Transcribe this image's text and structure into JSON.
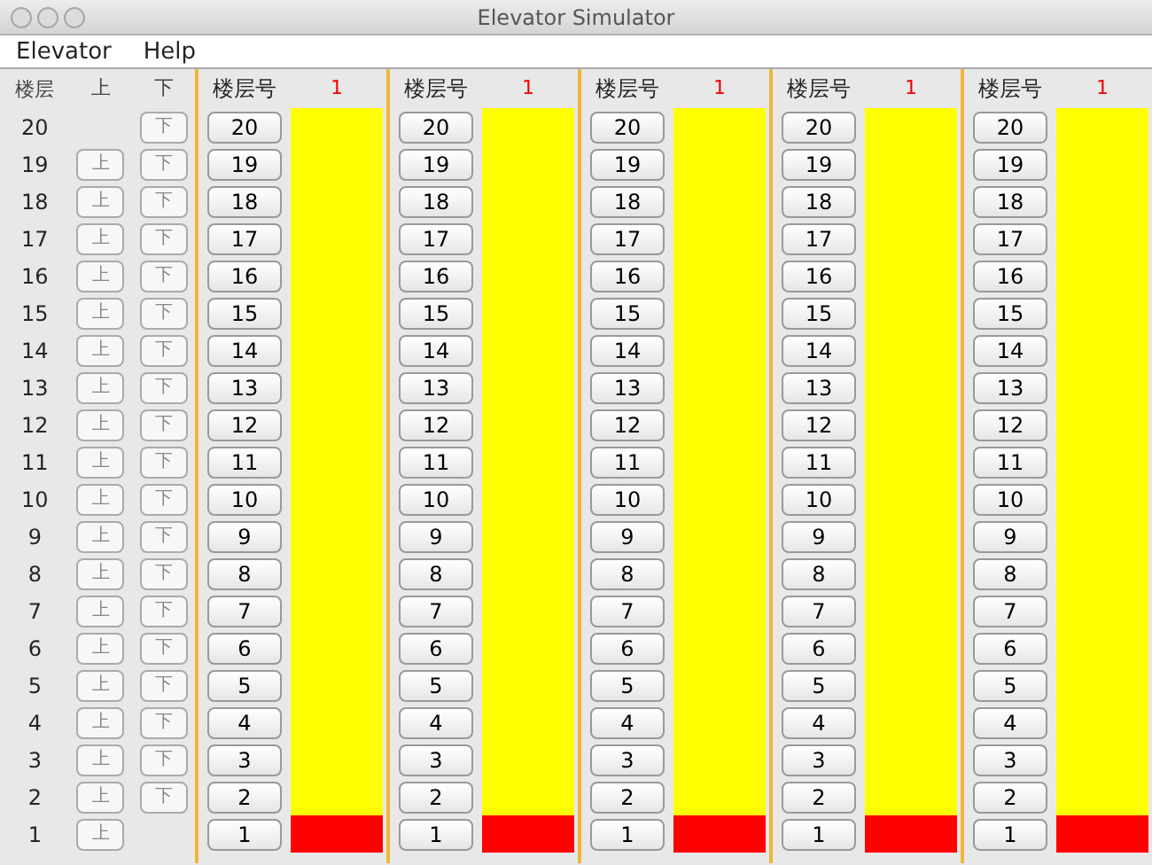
{
  "window": {
    "title": "Elevator Simulator"
  },
  "menu": [
    "Elevator",
    "Help"
  ],
  "hall": {
    "headers": [
      "楼层",
      "上",
      "下"
    ],
    "rows": [
      {
        "floor": "20",
        "down": "下"
      },
      {
        "floor": "19",
        "up": "上",
        "down": "下"
      },
      {
        "floor": "18",
        "up": "上",
        "down": "下"
      },
      {
        "floor": "17",
        "up": "上",
        "down": "下"
      },
      {
        "floor": "16",
        "up": "上",
        "down": "下"
      },
      {
        "floor": "15",
        "up": "上",
        "down": "下"
      },
      {
        "floor": "14",
        "up": "上",
        "down": "下"
      },
      {
        "floor": "13",
        "up": "上",
        "down": "下"
      },
      {
        "floor": "12",
        "up": "上",
        "down": "下"
      },
      {
        "floor": "11",
        "up": "上",
        "down": "下"
      },
      {
        "floor": "10",
        "up": "上",
        "down": "下"
      },
      {
        "floor": "9",
        "up": "上",
        "down": "下"
      },
      {
        "floor": "8",
        "up": "上",
        "down": "下"
      },
      {
        "floor": "7",
        "up": "上",
        "down": "下"
      },
      {
        "floor": "6",
        "up": "上",
        "down": "下"
      },
      {
        "floor": "5",
        "up": "上",
        "down": "下"
      },
      {
        "floor": "4",
        "up": "上",
        "down": "下"
      },
      {
        "floor": "3",
        "up": "上",
        "down": "下"
      },
      {
        "floor": "2",
        "up": "上",
        "down": "下"
      },
      {
        "floor": "1",
        "up": "上"
      }
    ]
  },
  "elevators": [
    {
      "header": "楼层号",
      "display": "1",
      "floors": [
        {
          "label": "20",
          "car": false
        },
        {
          "label": "19",
          "car": false
        },
        {
          "label": "18",
          "car": false
        },
        {
          "label": "17",
          "car": false
        },
        {
          "label": "16",
          "car": false
        },
        {
          "label": "15",
          "car": false
        },
        {
          "label": "14",
          "car": false
        },
        {
          "label": "13",
          "car": false
        },
        {
          "label": "12",
          "car": false
        },
        {
          "label": "11",
          "car": false
        },
        {
          "label": "10",
          "car": false
        },
        {
          "label": "9",
          "car": false
        },
        {
          "label": "8",
          "car": false
        },
        {
          "label": "7",
          "car": false
        },
        {
          "label": "6",
          "car": false
        },
        {
          "label": "5",
          "car": false
        },
        {
          "label": "4",
          "car": false
        },
        {
          "label": "3",
          "car": false
        },
        {
          "label": "2",
          "car": false
        },
        {
          "label": "1",
          "car": true
        }
      ]
    },
    {
      "header": "楼层号",
      "display": "1",
      "floors": [
        {
          "label": "20",
          "car": false
        },
        {
          "label": "19",
          "car": false
        },
        {
          "label": "18",
          "car": false
        },
        {
          "label": "17",
          "car": false
        },
        {
          "label": "16",
          "car": false
        },
        {
          "label": "15",
          "car": false
        },
        {
          "label": "14",
          "car": false
        },
        {
          "label": "13",
          "car": false
        },
        {
          "label": "12",
          "car": false
        },
        {
          "label": "11",
          "car": false
        },
        {
          "label": "10",
          "car": false
        },
        {
          "label": "9",
          "car": false
        },
        {
          "label": "8",
          "car": false
        },
        {
          "label": "7",
          "car": false
        },
        {
          "label": "6",
          "car": false
        },
        {
          "label": "5",
          "car": false
        },
        {
          "label": "4",
          "car": false
        },
        {
          "label": "3",
          "car": false
        },
        {
          "label": "2",
          "car": false
        },
        {
          "label": "1",
          "car": true
        }
      ]
    },
    {
      "header": "楼层号",
      "display": "1",
      "floors": [
        {
          "label": "20",
          "car": false
        },
        {
          "label": "19",
          "car": false
        },
        {
          "label": "18",
          "car": false
        },
        {
          "label": "17",
          "car": false
        },
        {
          "label": "16",
          "car": false
        },
        {
          "label": "15",
          "car": false
        },
        {
          "label": "14",
          "car": false
        },
        {
          "label": "13",
          "car": false
        },
        {
          "label": "12",
          "car": false
        },
        {
          "label": "11",
          "car": false
        },
        {
          "label": "10",
          "car": false
        },
        {
          "label": "9",
          "car": false
        },
        {
          "label": "8",
          "car": false
        },
        {
          "label": "7",
          "car": false
        },
        {
          "label": "6",
          "car": false
        },
        {
          "label": "5",
          "car": false
        },
        {
          "label": "4",
          "car": false
        },
        {
          "label": "3",
          "car": false
        },
        {
          "label": "2",
          "car": false
        },
        {
          "label": "1",
          "car": true
        }
      ]
    },
    {
      "header": "楼层号",
      "display": "1",
      "floors": [
        {
          "label": "20",
          "car": false
        },
        {
          "label": "19",
          "car": false
        },
        {
          "label": "18",
          "car": false
        },
        {
          "label": "17",
          "car": false
        },
        {
          "label": "16",
          "car": false
        },
        {
          "label": "15",
          "car": false
        },
        {
          "label": "14",
          "car": false
        },
        {
          "label": "13",
          "car": false
        },
        {
          "label": "12",
          "car": false
        },
        {
          "label": "11",
          "car": false
        },
        {
          "label": "10",
          "car": false
        },
        {
          "label": "9",
          "car": false
        },
        {
          "label": "8",
          "car": false
        },
        {
          "label": "7",
          "car": false
        },
        {
          "label": "6",
          "car": false
        },
        {
          "label": "5",
          "car": false
        },
        {
          "label": "4",
          "car": false
        },
        {
          "label": "3",
          "car": false
        },
        {
          "label": "2",
          "car": false
        },
        {
          "label": "1",
          "car": true
        }
      ]
    },
    {
      "header": "楼层号",
      "display": "1",
      "floors": [
        {
          "label": "20",
          "car": false
        },
        {
          "label": "19",
          "car": false
        },
        {
          "label": "18",
          "car": false
        },
        {
          "label": "17",
          "car": false
        },
        {
          "label": "16",
          "car": false
        },
        {
          "label": "15",
          "car": false
        },
        {
          "label": "14",
          "car": false
        },
        {
          "label": "13",
          "car": false
        },
        {
          "label": "12",
          "car": false
        },
        {
          "label": "11",
          "car": false
        },
        {
          "label": "10",
          "car": false
        },
        {
          "label": "9",
          "car": false
        },
        {
          "label": "8",
          "car": false
        },
        {
          "label": "7",
          "car": false
        },
        {
          "label": "6",
          "car": false
        },
        {
          "label": "5",
          "car": false
        },
        {
          "label": "4",
          "car": false
        },
        {
          "label": "3",
          "car": false
        },
        {
          "label": "2",
          "car": false
        },
        {
          "label": "1",
          "car": true
        }
      ]
    }
  ]
}
